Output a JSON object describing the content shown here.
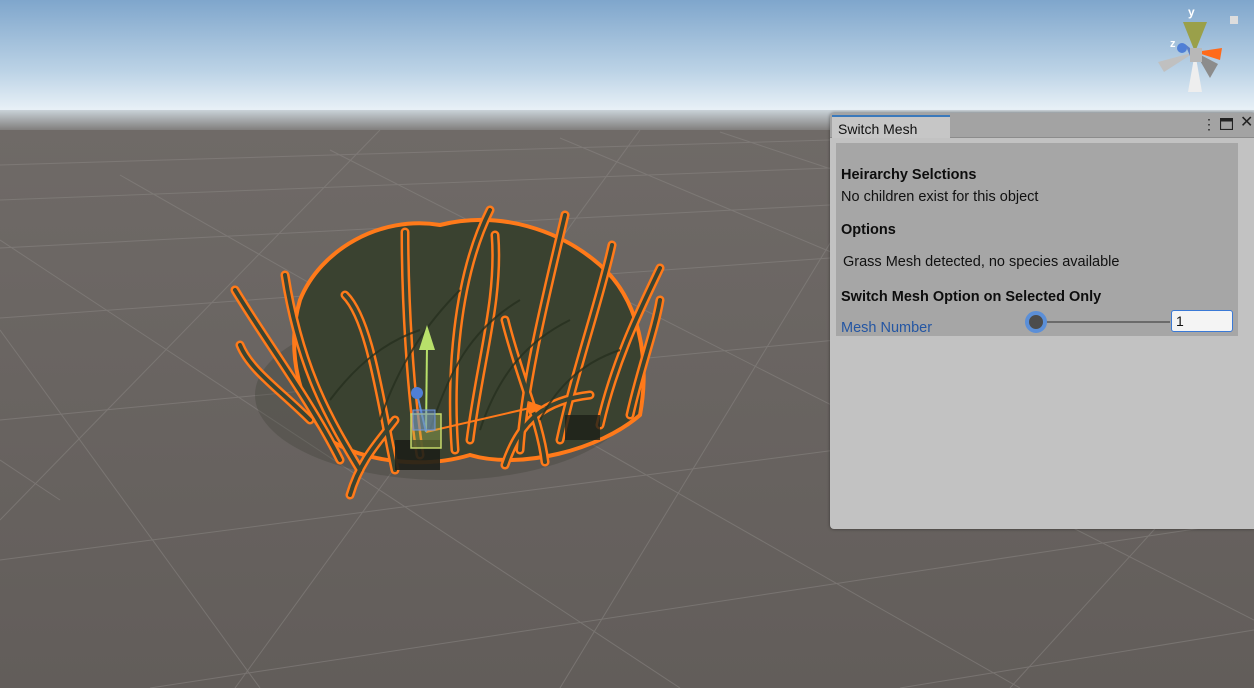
{
  "gizmo": {
    "y_label": "y",
    "z_label": "z"
  },
  "window": {
    "tab_title": "Switch Mesh",
    "menu_icon": "kebab-menu-icon",
    "maximize_icon": "maximize-icon",
    "close_icon": "close-icon"
  },
  "sections": {
    "hierarchy_header": "Heirarchy Selctions",
    "hierarchy_text": "No children exist for this object",
    "options_header": "Options",
    "options_text": "Grass Mesh detected, no species available",
    "switch_header": "Switch Mesh Option on Selected Only"
  },
  "mesh_number": {
    "label": "Mesh Number",
    "value": "1",
    "slider_fraction": 0
  },
  "colors": {
    "accent": "#3a79bb",
    "selection_outline": "#ff7a1a",
    "panel_bg": "#c2c2c2",
    "content_bg": "#a6a6a6"
  }
}
